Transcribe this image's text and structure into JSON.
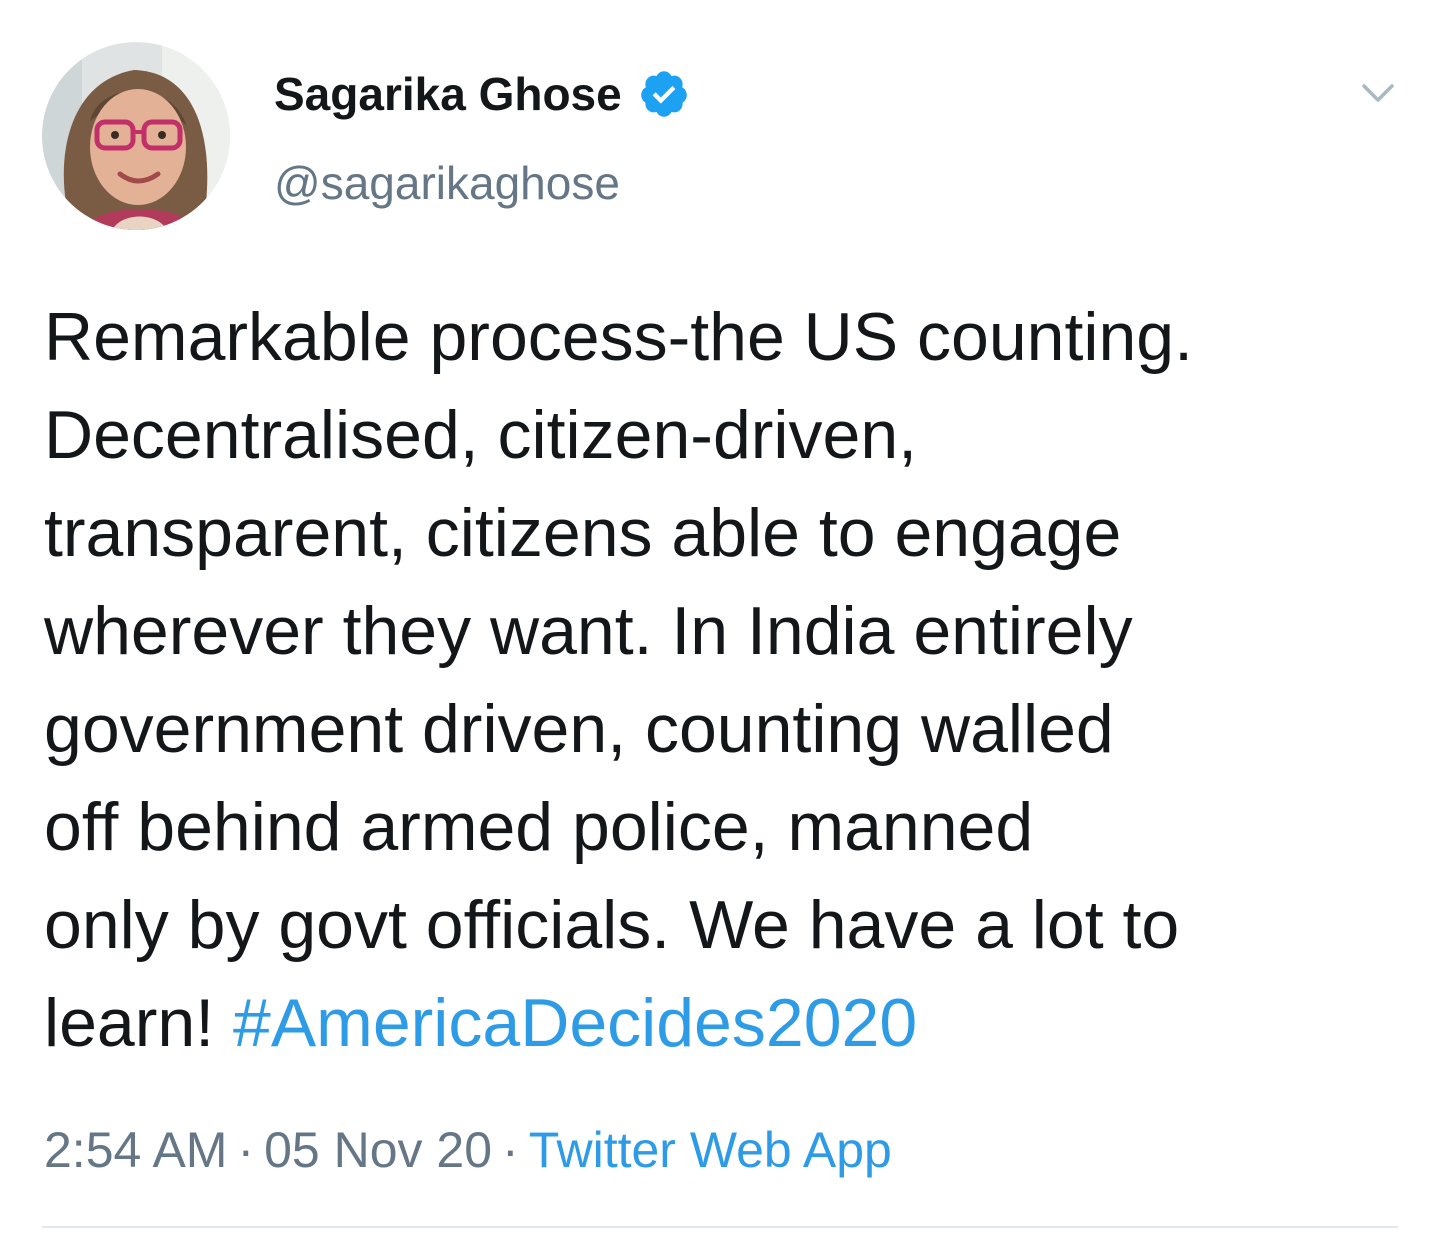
{
  "tweet": {
    "author": {
      "display_name": "Sagarika Ghose",
      "handle": "@sagarikaghose",
      "verified": true,
      "avatar_icon": "profile-photo"
    },
    "menu_icon": "chevron-down-icon",
    "text_lines": [
      "Remarkable process-the US counting.",
      "Decentralised, citizen-driven,",
      "transparent, citizens able to engage",
      "wherever they want. In India entirely",
      "government driven, counting walled",
      "off behind armed police, manned",
      "only by govt officials. We have a lot to"
    ],
    "last_line_prefix": "learn! ",
    "hashtag": "#AmericaDecides2020",
    "time": "2:54 AM",
    "date": "05 Nov 20",
    "source": "Twitter Web App",
    "separator": "·"
  },
  "colors": {
    "text": "#14171a",
    "secondary": "#657786",
    "link": "#2e9be6",
    "verified": "#1da1f2",
    "divider": "#e1e8ed"
  }
}
